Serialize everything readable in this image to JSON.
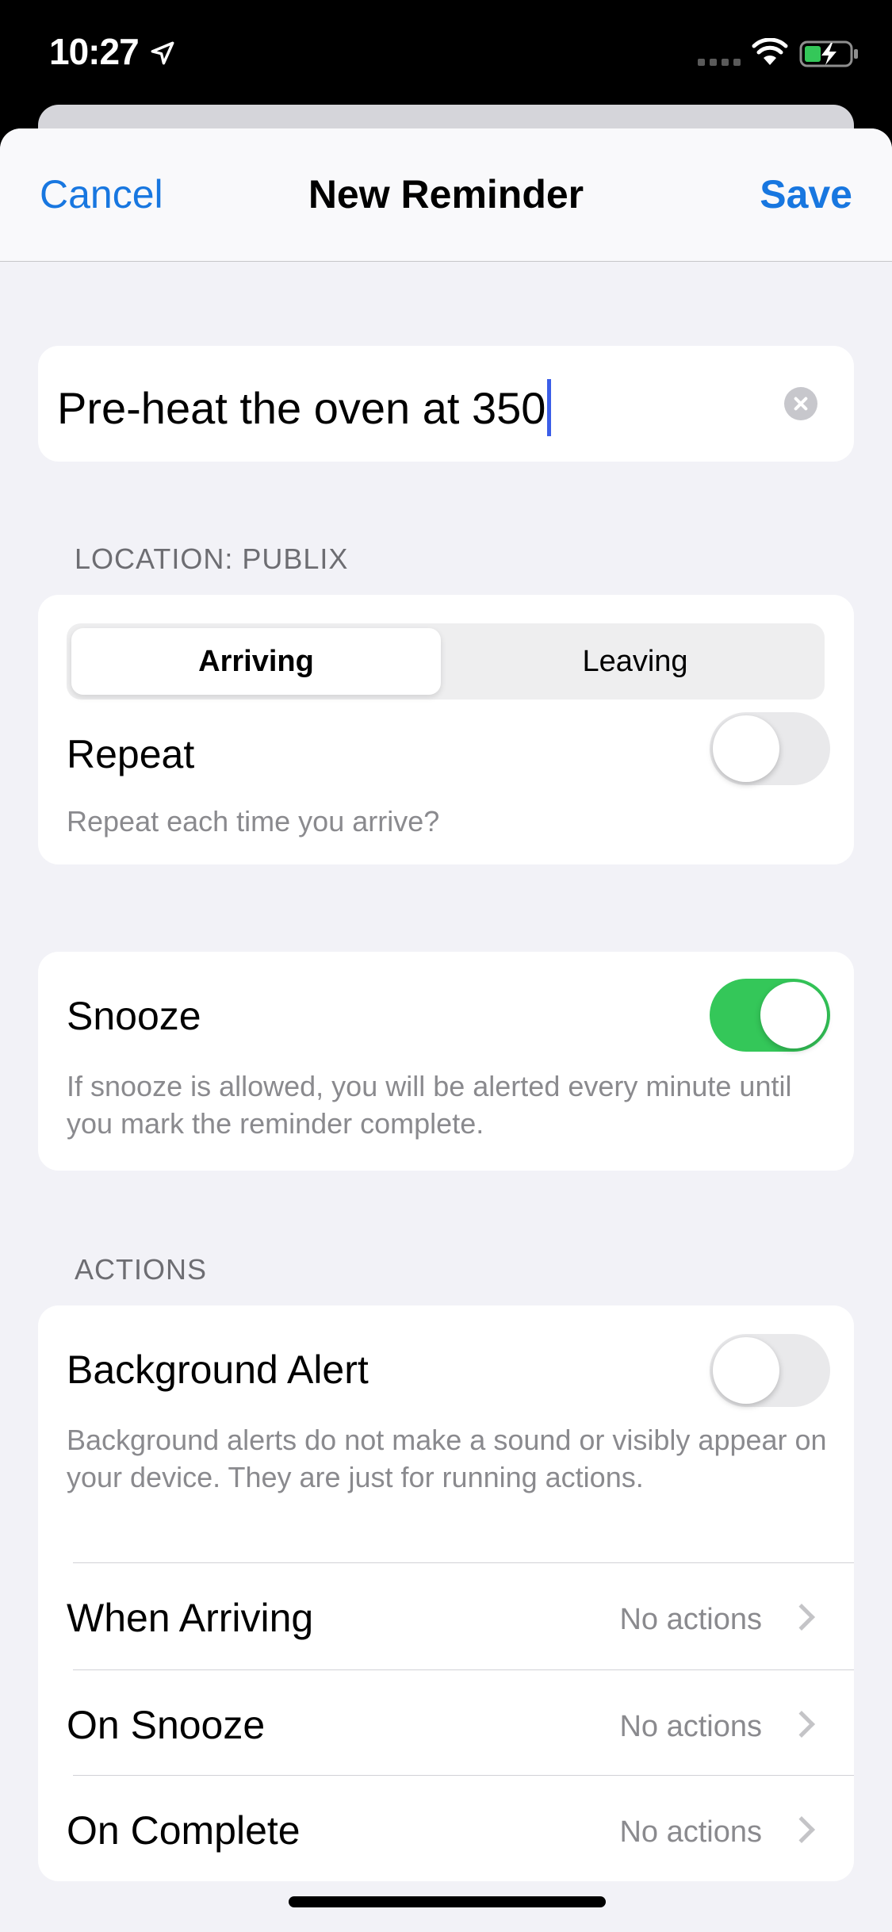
{
  "status_bar": {
    "time": "10:27"
  },
  "nav": {
    "cancel": "Cancel",
    "title": "New Reminder",
    "save": "Save"
  },
  "reminder": {
    "title_value": "Pre-heat the oven at 350"
  },
  "location": {
    "header": "LOCATION: PUBLIX",
    "segments": [
      "Arriving",
      "Leaving"
    ],
    "selected_segment": "Arriving",
    "repeat_label": "Repeat",
    "repeat_on": false,
    "repeat_sub": "Repeat each time you arrive?"
  },
  "snooze": {
    "label": "Snooze",
    "on": true,
    "sub": "If snooze is allowed, you will be alerted every minute until you mark the reminder complete."
  },
  "actions": {
    "header": "ACTIONS",
    "background_alert_label": "Background Alert",
    "background_alert_on": false,
    "background_alert_sub": "Background alerts do not make a sound or visibly appear on your device. They are just for running actions.",
    "rows": [
      {
        "label": "When Arriving",
        "value": "No actions"
      },
      {
        "label": "On Snooze",
        "value": "No actions"
      },
      {
        "label": "On Complete",
        "value": "No actions"
      }
    ]
  },
  "colors": {
    "accent": "#1877e0",
    "toggle_on": "#34c759",
    "background": "#f2f2f7"
  },
  "icons": [
    "location-arrow-icon",
    "cellular-signal-icon",
    "wifi-icon",
    "battery-charging-icon",
    "clear-icon",
    "chevron-right-icon"
  ]
}
